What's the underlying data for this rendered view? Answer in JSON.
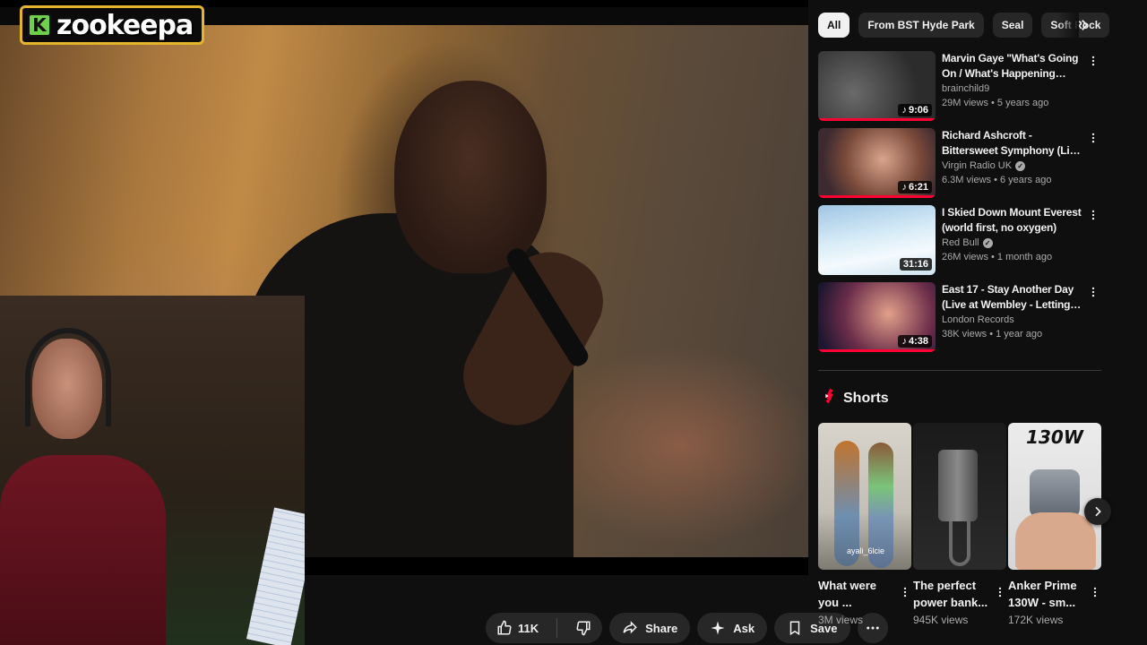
{
  "overlay": {
    "logo_letter": "K",
    "logo_text": "zookeepa"
  },
  "actions": {
    "like_count": "11K",
    "share_label": "Share",
    "ask_label": "Ask",
    "save_label": "Save"
  },
  "chips": [
    {
      "label": "All",
      "active": true
    },
    {
      "label": "From BST Hyde Park",
      "active": false
    },
    {
      "label": "Seal",
      "active": false
    },
    {
      "label": "Soft Rock",
      "active": false
    }
  ],
  "videos": [
    {
      "title": "Marvin Gaye \"What's Going On / What's Happening Brother\"",
      "channel": "brainchild9",
      "verified": false,
      "meta": "29M views • 5 years ago",
      "duration": "9:06",
      "music_icon": true,
      "watched": true
    },
    {
      "title": "Richard Ashcroft - Bittersweet Symphony (Live on The Chris ...",
      "channel": "Virgin Radio UK",
      "verified": true,
      "meta": "6.3M views • 6 years ago",
      "duration": "6:21",
      "music_icon": true,
      "watched": true
    },
    {
      "title": "I Skied Down Mount Everest (world first, no oxygen)",
      "channel": "Red Bull",
      "verified": true,
      "meta": "26M views • 1 month ago",
      "duration": "31:16",
      "music_icon": false,
      "watched": false
    },
    {
      "title": "East 17 - Stay Another Day (Live at Wembley - Letting Off Stea...",
      "channel": "London Records",
      "verified": false,
      "meta": "38K views • 1 year ago",
      "duration": "4:38",
      "music_icon": true,
      "watched": true
    }
  ],
  "shorts": {
    "heading": "Shorts",
    "items": [
      {
        "title": "What were you ...",
        "views": "3M views",
        "thumb_text": "ayali_6lcie"
      },
      {
        "title": "The perfect power bank...",
        "views": "945K views",
        "thumb_text": ""
      },
      {
        "title": "Anker Prime 130W - sm...",
        "views": "172K views",
        "thumb_text": "130W"
      }
    ]
  },
  "colors": {
    "background": "#0f0f0f",
    "progress": "#ff0033",
    "shorts_icon": "#ff0033",
    "logo_border": "#e2b52b",
    "logo_k": "#6fd14b"
  }
}
